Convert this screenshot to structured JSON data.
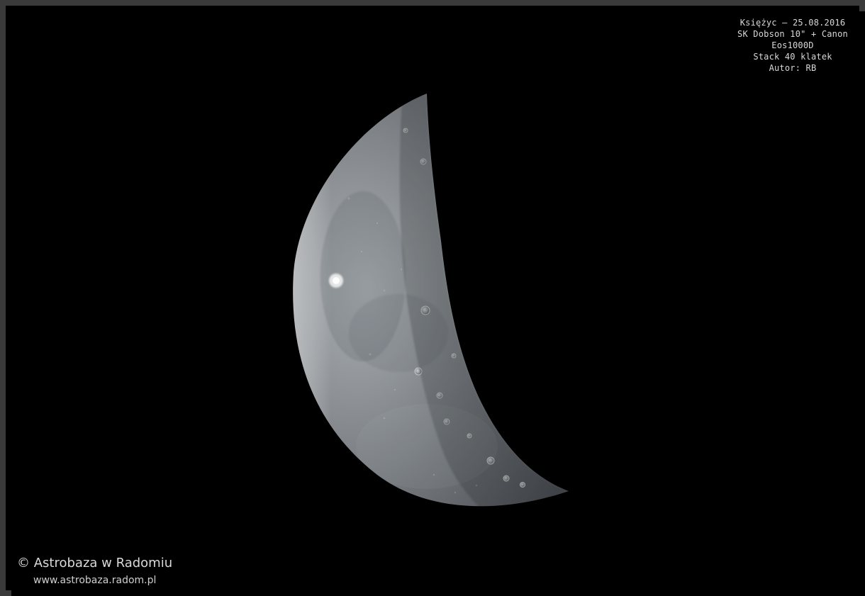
{
  "caption": {
    "lines": [
      "Księżyc – 25.08.2016",
      "SK Dobson 10\" + Canon",
      "Eos1000D",
      "Stack 40 klatek",
      "Autor: RB"
    ]
  },
  "watermark": {
    "title": "© Astrobaza w Radomiu",
    "url": "www.astrobaza.radom.pl"
  },
  "colors": {
    "background": "#000000",
    "frame": "#3a3a3a",
    "moon_light": "#c8c8c8",
    "moon_dark": "#4f5358",
    "text": "#d8d8d8"
  }
}
